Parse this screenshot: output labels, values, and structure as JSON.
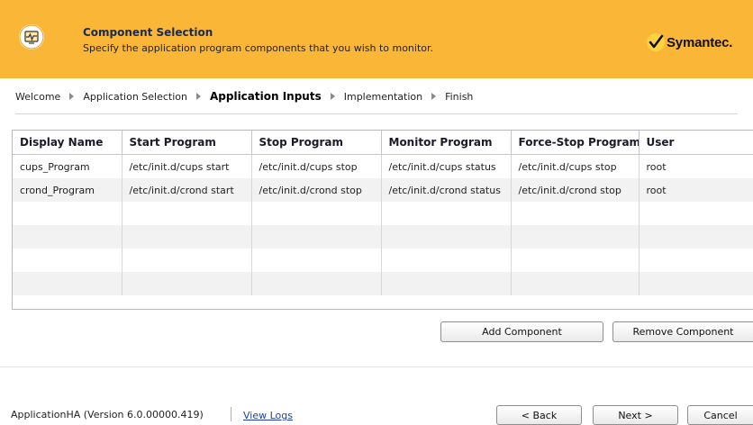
{
  "header": {
    "title": "Component Selection",
    "subtitle": "Specify the application program components that you wish to monitor.",
    "brand": "Symantec.",
    "accent_color": "#fab637",
    "icon": "monitor-pulse-icon"
  },
  "breadcrumb": {
    "items": [
      {
        "label": "Welcome",
        "active": false
      },
      {
        "label": "Application Selection",
        "active": false
      },
      {
        "label": "Application Inputs",
        "active": true
      },
      {
        "label": "Implementation",
        "active": false
      },
      {
        "label": "Finish",
        "active": false
      }
    ]
  },
  "table": {
    "columns": [
      "Display Name",
      "Start Program",
      "Stop Program",
      "Monitor Program",
      "Force-Stop Program",
      "User"
    ],
    "rows": [
      [
        "cups_Program",
        "/etc/init.d/cups start",
        "/etc/init.d/cups stop",
        "/etc/init.d/cups status",
        "/etc/init.d/cups stop",
        "root"
      ],
      [
        "crond_Program",
        "/etc/init.d/crond start",
        "/etc/init.d/crond stop",
        "/etc/init.d/crond status",
        "/etc/init.d/crond stop",
        "root"
      ],
      [
        "",
        "",
        "",
        "",
        "",
        ""
      ],
      [
        "",
        "",
        "",
        "",
        "",
        ""
      ],
      [
        "",
        "",
        "",
        "",
        "",
        ""
      ],
      [
        "",
        "",
        "",
        "",
        "",
        ""
      ]
    ]
  },
  "actions": {
    "add_label": "Add Component",
    "remove_label": "Remove Component"
  },
  "footer": {
    "version": "ApplicationHA (Version 6.0.00000.419)",
    "view_logs": "View Logs",
    "back_label": "< Back",
    "next_label": "Next >",
    "cancel_label": "Cancel"
  }
}
